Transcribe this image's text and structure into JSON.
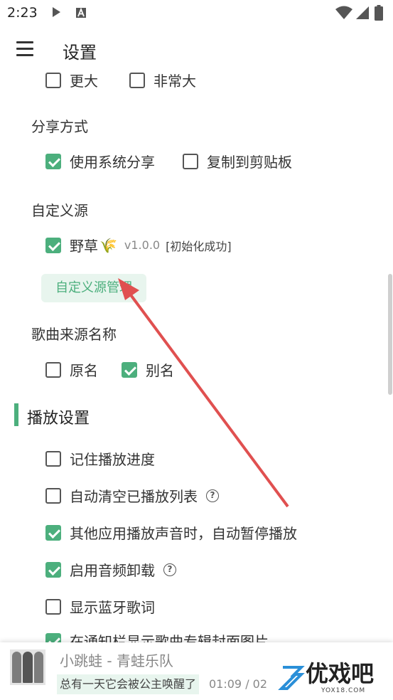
{
  "status_bar": {
    "time": "2:23"
  },
  "app_bar": {
    "title": "设置"
  },
  "font_size_options": [
    {
      "label": "更大",
      "checked": false
    },
    {
      "label": "非常大",
      "checked": false
    }
  ],
  "share": {
    "heading": "分享方式",
    "options": [
      {
        "label": "使用系统分享",
        "checked": true
      },
      {
        "label": "复制到剪贴板",
        "checked": false
      }
    ]
  },
  "custom_source": {
    "heading": "自定义源",
    "item": {
      "label": "野草",
      "emoji": "🌾",
      "version": "v1.0.0",
      "status": "[初始化成功]",
      "checked": true
    },
    "manage_button": "自定义源管理"
  },
  "song_source_name": {
    "heading": "歌曲来源名称",
    "options": [
      {
        "label": "原名",
        "checked": false
      },
      {
        "label": "别名",
        "checked": true
      }
    ]
  },
  "playback": {
    "title": "播放设置",
    "options": [
      {
        "label": "记住播放进度",
        "checked": false,
        "help": false
      },
      {
        "label": "自动清空已播放列表",
        "checked": false,
        "help": true
      },
      {
        "label": "其他应用播放声音时，自动暂停播放",
        "checked": true,
        "help": false
      },
      {
        "label": "启用音频卸载",
        "checked": true,
        "help": true
      },
      {
        "label": "显示蓝牙歌词",
        "checked": false,
        "help": false
      },
      {
        "label": "在通知栏显示歌曲专辑封面图片",
        "checked": true,
        "help": false
      }
    ]
  },
  "player": {
    "song": "小跳蛙 - 青蛙乐队",
    "lyric": "总有一天它会被公主唤醒了",
    "time": "01:09 / 02"
  },
  "watermark": {
    "text": "优戏吧",
    "url": "YOX18.COM"
  },
  "colors": {
    "accent": "#4caf7d",
    "arrow": "#e05050"
  }
}
